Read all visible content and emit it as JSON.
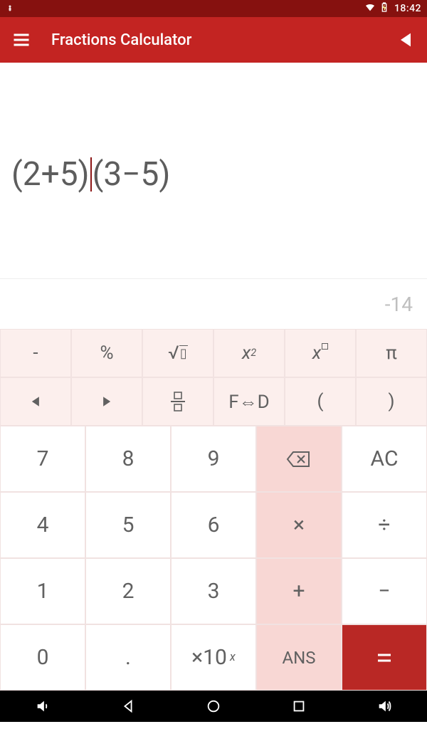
{
  "status": {
    "time": "18:42"
  },
  "app": {
    "title": "Fractions Calculator"
  },
  "display": {
    "expr_before": "(2+5)",
    "expr_after": "(3−5)",
    "result": "-14"
  },
  "keys": {
    "fn1": {
      "neg": "-",
      "pct": "%",
      "sqrt": "√▯",
      "sq": "𝑥²",
      "pow": "𝑥",
      "pi": "π"
    },
    "fn2": {
      "left": "◀",
      "right": "▶",
      "frac": "frac",
      "fd": "F⇔D",
      "lp": "(",
      "rp": ")"
    },
    "r1": {
      "k7": "7",
      "k8": "8",
      "k9": "9",
      "bs": "bs",
      "ac": "AC"
    },
    "r2": {
      "k4": "4",
      "k5": "5",
      "k6": "6",
      "mul": "×",
      "div": "÷"
    },
    "r3": {
      "k1": "1",
      "k2": "2",
      "k3": "3",
      "add": "+",
      "sub": "−"
    },
    "r4": {
      "k0": "0",
      "dot": ".",
      "e10": "×10",
      "ans": "ANS",
      "eq": "="
    }
  }
}
